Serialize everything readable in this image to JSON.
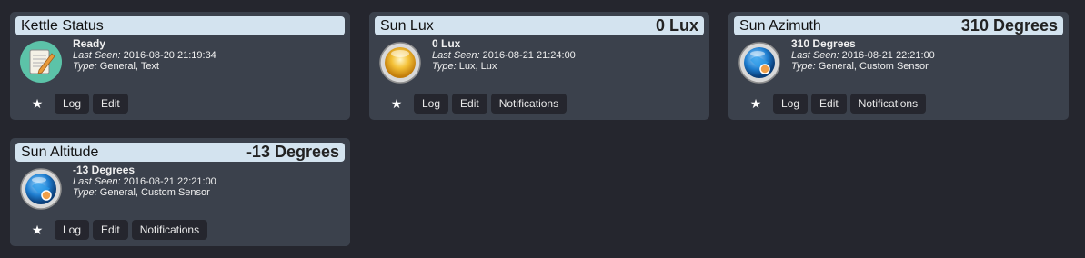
{
  "devices": [
    {
      "title": "Kettle Status",
      "header_value": "",
      "status": "Ready",
      "last_seen_label": "Last Seen:",
      "last_seen": "2016-08-20 21:19:34",
      "type_label": "Type:",
      "type": "General, Text",
      "icon": "notepad-text-icon",
      "buttons": [
        "Log",
        "Edit"
      ]
    },
    {
      "title": "Sun Lux",
      "header_value": "0 Lux",
      "status": "0 Lux",
      "last_seen_label": "Last Seen:",
      "last_seen": "2016-08-21 21:24:00",
      "type_label": "Type:",
      "type": "Lux, Lux",
      "icon": "lux-bulb-icon",
      "buttons": [
        "Log",
        "Edit",
        "Notifications"
      ]
    },
    {
      "title": "Sun Azimuth",
      "header_value": "310 Degrees",
      "status": "310 Degrees",
      "last_seen_label": "Last Seen:",
      "last_seen": "2016-08-21 22:21:00",
      "type_label": "Type:",
      "type": "General, Custom Sensor",
      "icon": "custom-sensor-globe-icon",
      "buttons": [
        "Log",
        "Edit",
        "Notifications"
      ]
    },
    {
      "title": "Sun Altitude",
      "header_value": "-13 Degrees",
      "status": "-13 Degrees",
      "last_seen_label": "Last Seen:",
      "last_seen": "2016-08-21 22:21:00",
      "type_label": "Type:",
      "type": "General, Custom Sensor",
      "icon": "custom-sensor-globe-icon",
      "buttons": [
        "Log",
        "Edit",
        "Notifications"
      ]
    }
  ],
  "colors": {
    "page_bg": "#25262e",
    "card_bg": "#3b414c",
    "header_bg": "#d3e3ef"
  }
}
